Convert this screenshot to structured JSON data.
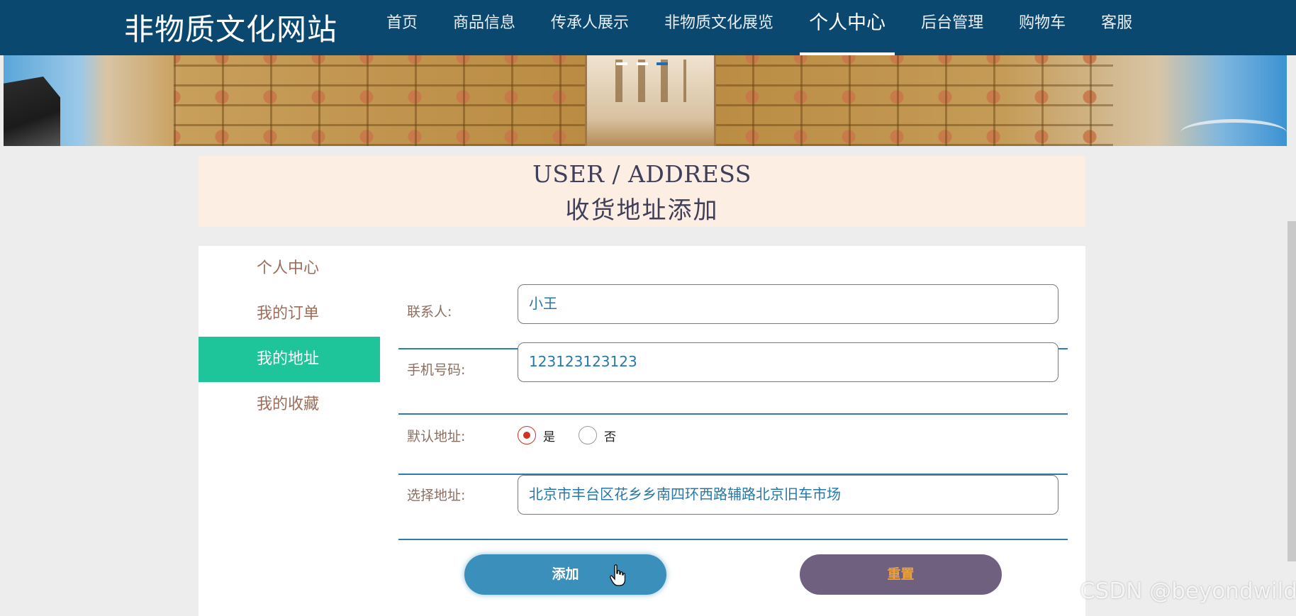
{
  "site": {
    "title": "非物质文化网站"
  },
  "nav": {
    "items": [
      "首页",
      "商品信息",
      "传承人展示",
      "非物质文化展览",
      "个人中心",
      "后台管理",
      "购物车",
      "客服"
    ],
    "active_index": 4
  },
  "page_head": {
    "en": "USER / ADDRESS",
    "cn": "收货地址添加"
  },
  "sidebar": {
    "items": [
      "个人中心",
      "我的订单",
      "我的地址",
      "我的收藏"
    ],
    "active_index": 2
  },
  "form": {
    "contact": {
      "label": "联系人:",
      "value": "小王"
    },
    "phone": {
      "label": "手机号码:",
      "value": "123123123123"
    },
    "default": {
      "label": "默认地址:",
      "options": [
        "是",
        "否"
      ],
      "selected": "是"
    },
    "address": {
      "label": "选择地址:",
      "value": "北京市丰台区花乡乡南四环西路辅路北京旧车市场"
    },
    "add_label": "添加",
    "reset_label": "重置"
  },
  "watermark": "CSDN @beyondwild",
  "colors": {
    "header": "#0b4870",
    "active_side": "#1ec49a",
    "add_button": "#3b8fbb",
    "reset_button": "#6f6080"
  }
}
